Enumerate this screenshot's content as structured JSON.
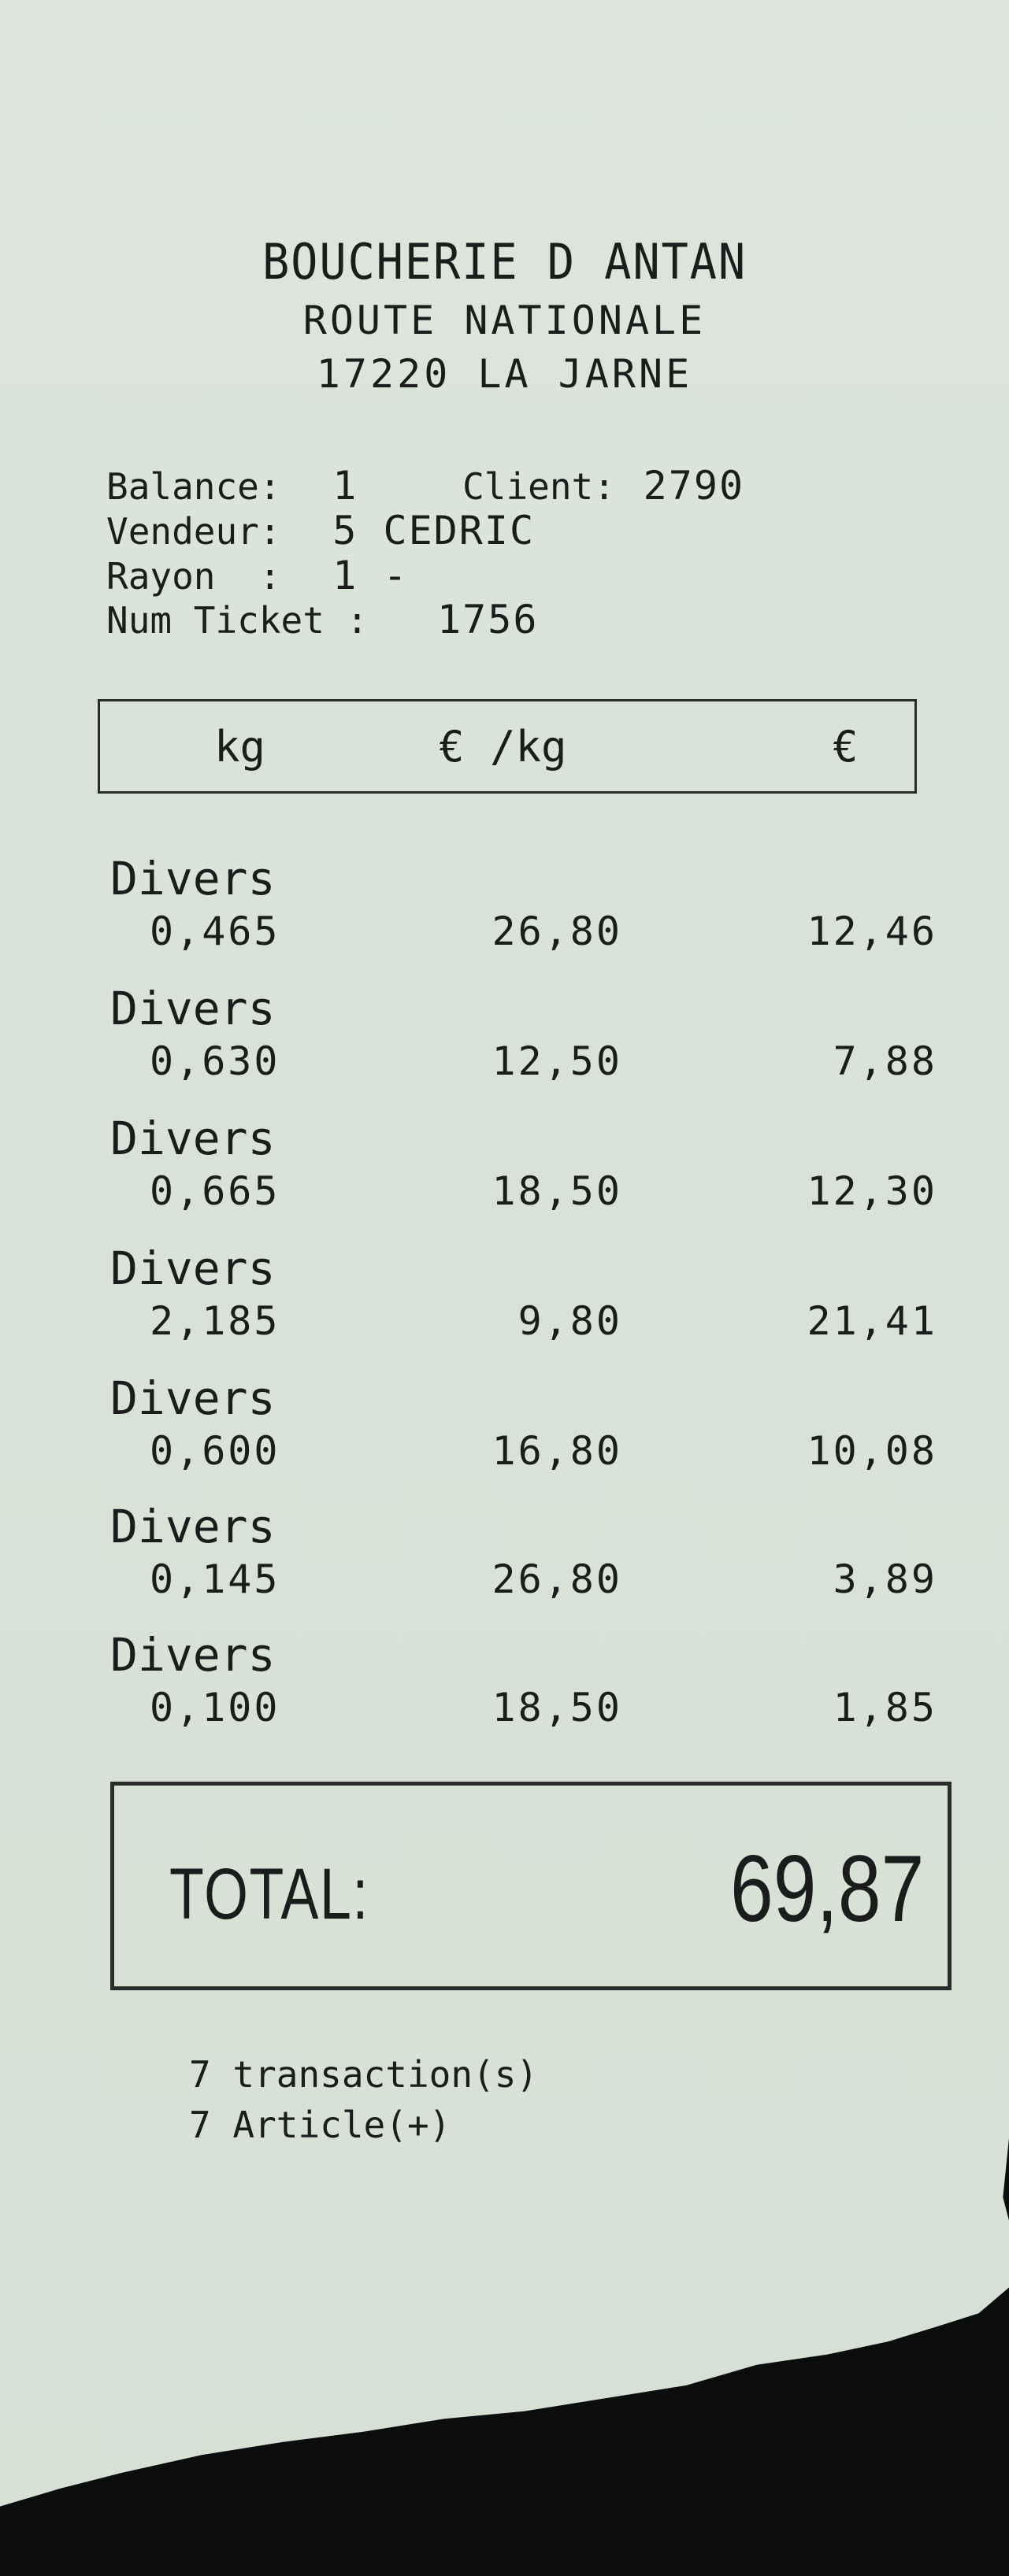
{
  "shop": {
    "name": "BOUCHERIE D ANTAN",
    "address": "ROUTE NATIONALE",
    "city": "17220 LA JARNE"
  },
  "info": {
    "balance_label": "Balance:",
    "balance_value": "1",
    "client_label": "Client:",
    "client_value": "2790",
    "vendeur_label": "Vendeur:",
    "vendeur_value": "5 CEDRIC",
    "rayon_label": "Rayon  :",
    "rayon_value": "1 -",
    "ticket_label": "Num Ticket :",
    "ticket_value": "1756"
  },
  "columns": {
    "weight": "kg",
    "unit_price": "€ /kg",
    "amount": "€"
  },
  "items": [
    {
      "name": "Divers",
      "weight": "0,465",
      "unit_price": "26,80",
      "amount": "12,46"
    },
    {
      "name": "Divers",
      "weight": "0,630",
      "unit_price": "12,50",
      "amount": "7,88"
    },
    {
      "name": "Divers",
      "weight": "0,665",
      "unit_price": "18,50",
      "amount": "12,30"
    },
    {
      "name": "Divers",
      "weight": "2,185",
      "unit_price": "9,80",
      "amount": "21,41"
    },
    {
      "name": "Divers",
      "weight": "0,600",
      "unit_price": "16,80",
      "amount": "10,08"
    },
    {
      "name": "Divers",
      "weight": "0,145",
      "unit_price": "26,80",
      "amount": "3,89"
    },
    {
      "name": "Divers",
      "weight": "0,100",
      "unit_price": "18,50",
      "amount": "1,85"
    }
  ],
  "total": {
    "label": "TOTAL:",
    "amount": "69,87"
  },
  "footer": {
    "transactions": "7 transaction(s)",
    "articles": "7 Article(+)"
  }
}
